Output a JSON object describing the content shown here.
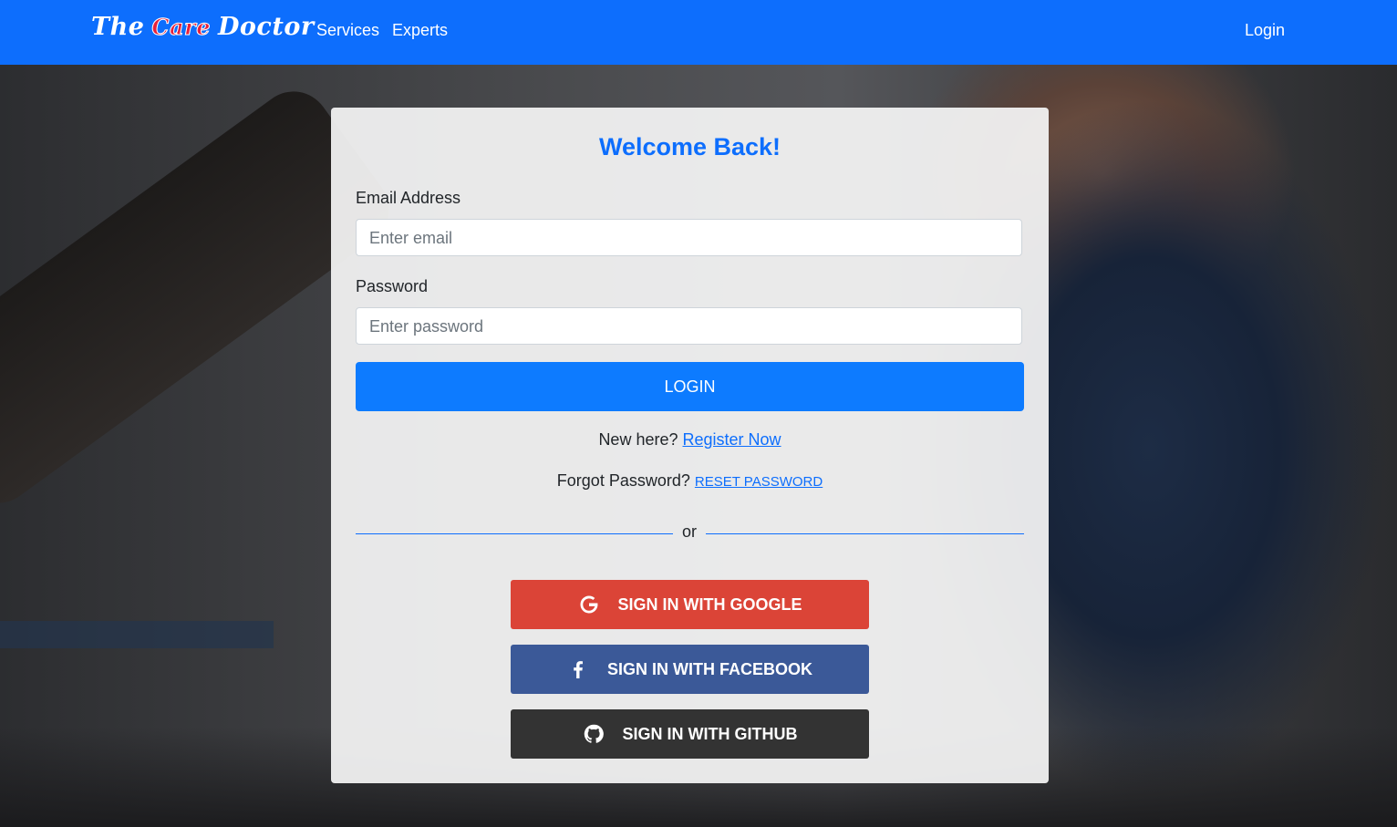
{
  "navbar": {
    "brand_left": "The",
    "brand_mid": "Care",
    "brand_right": "Doctor",
    "links": [
      "Services",
      "Experts"
    ],
    "login_label": "Login",
    "color": "#0d6efd"
  },
  "login_card": {
    "title": "Welcome Back!",
    "email_label": "Email Address",
    "email_placeholder": "Enter email",
    "password_label": "Password",
    "password_placeholder": "Enter password",
    "login_button": "LOGIN",
    "register_prompt": "New here?",
    "register_link": "Register Now",
    "forgot_prompt": "Forgot Password?",
    "reset_link": "RESET PASSWORD",
    "divider_text": "or"
  },
  "social": {
    "google": {
      "label": "SIGN IN WITH GOOGLE",
      "icon": "google-icon",
      "color": "#db4437"
    },
    "facebook": {
      "label": "SIGN IN WITH FACEBOOK",
      "icon": "facebook-icon",
      "color": "#3b5998"
    },
    "github": {
      "label": "SIGN IN WITH GITHUB",
      "icon": "github-icon",
      "color": "#333333"
    }
  }
}
